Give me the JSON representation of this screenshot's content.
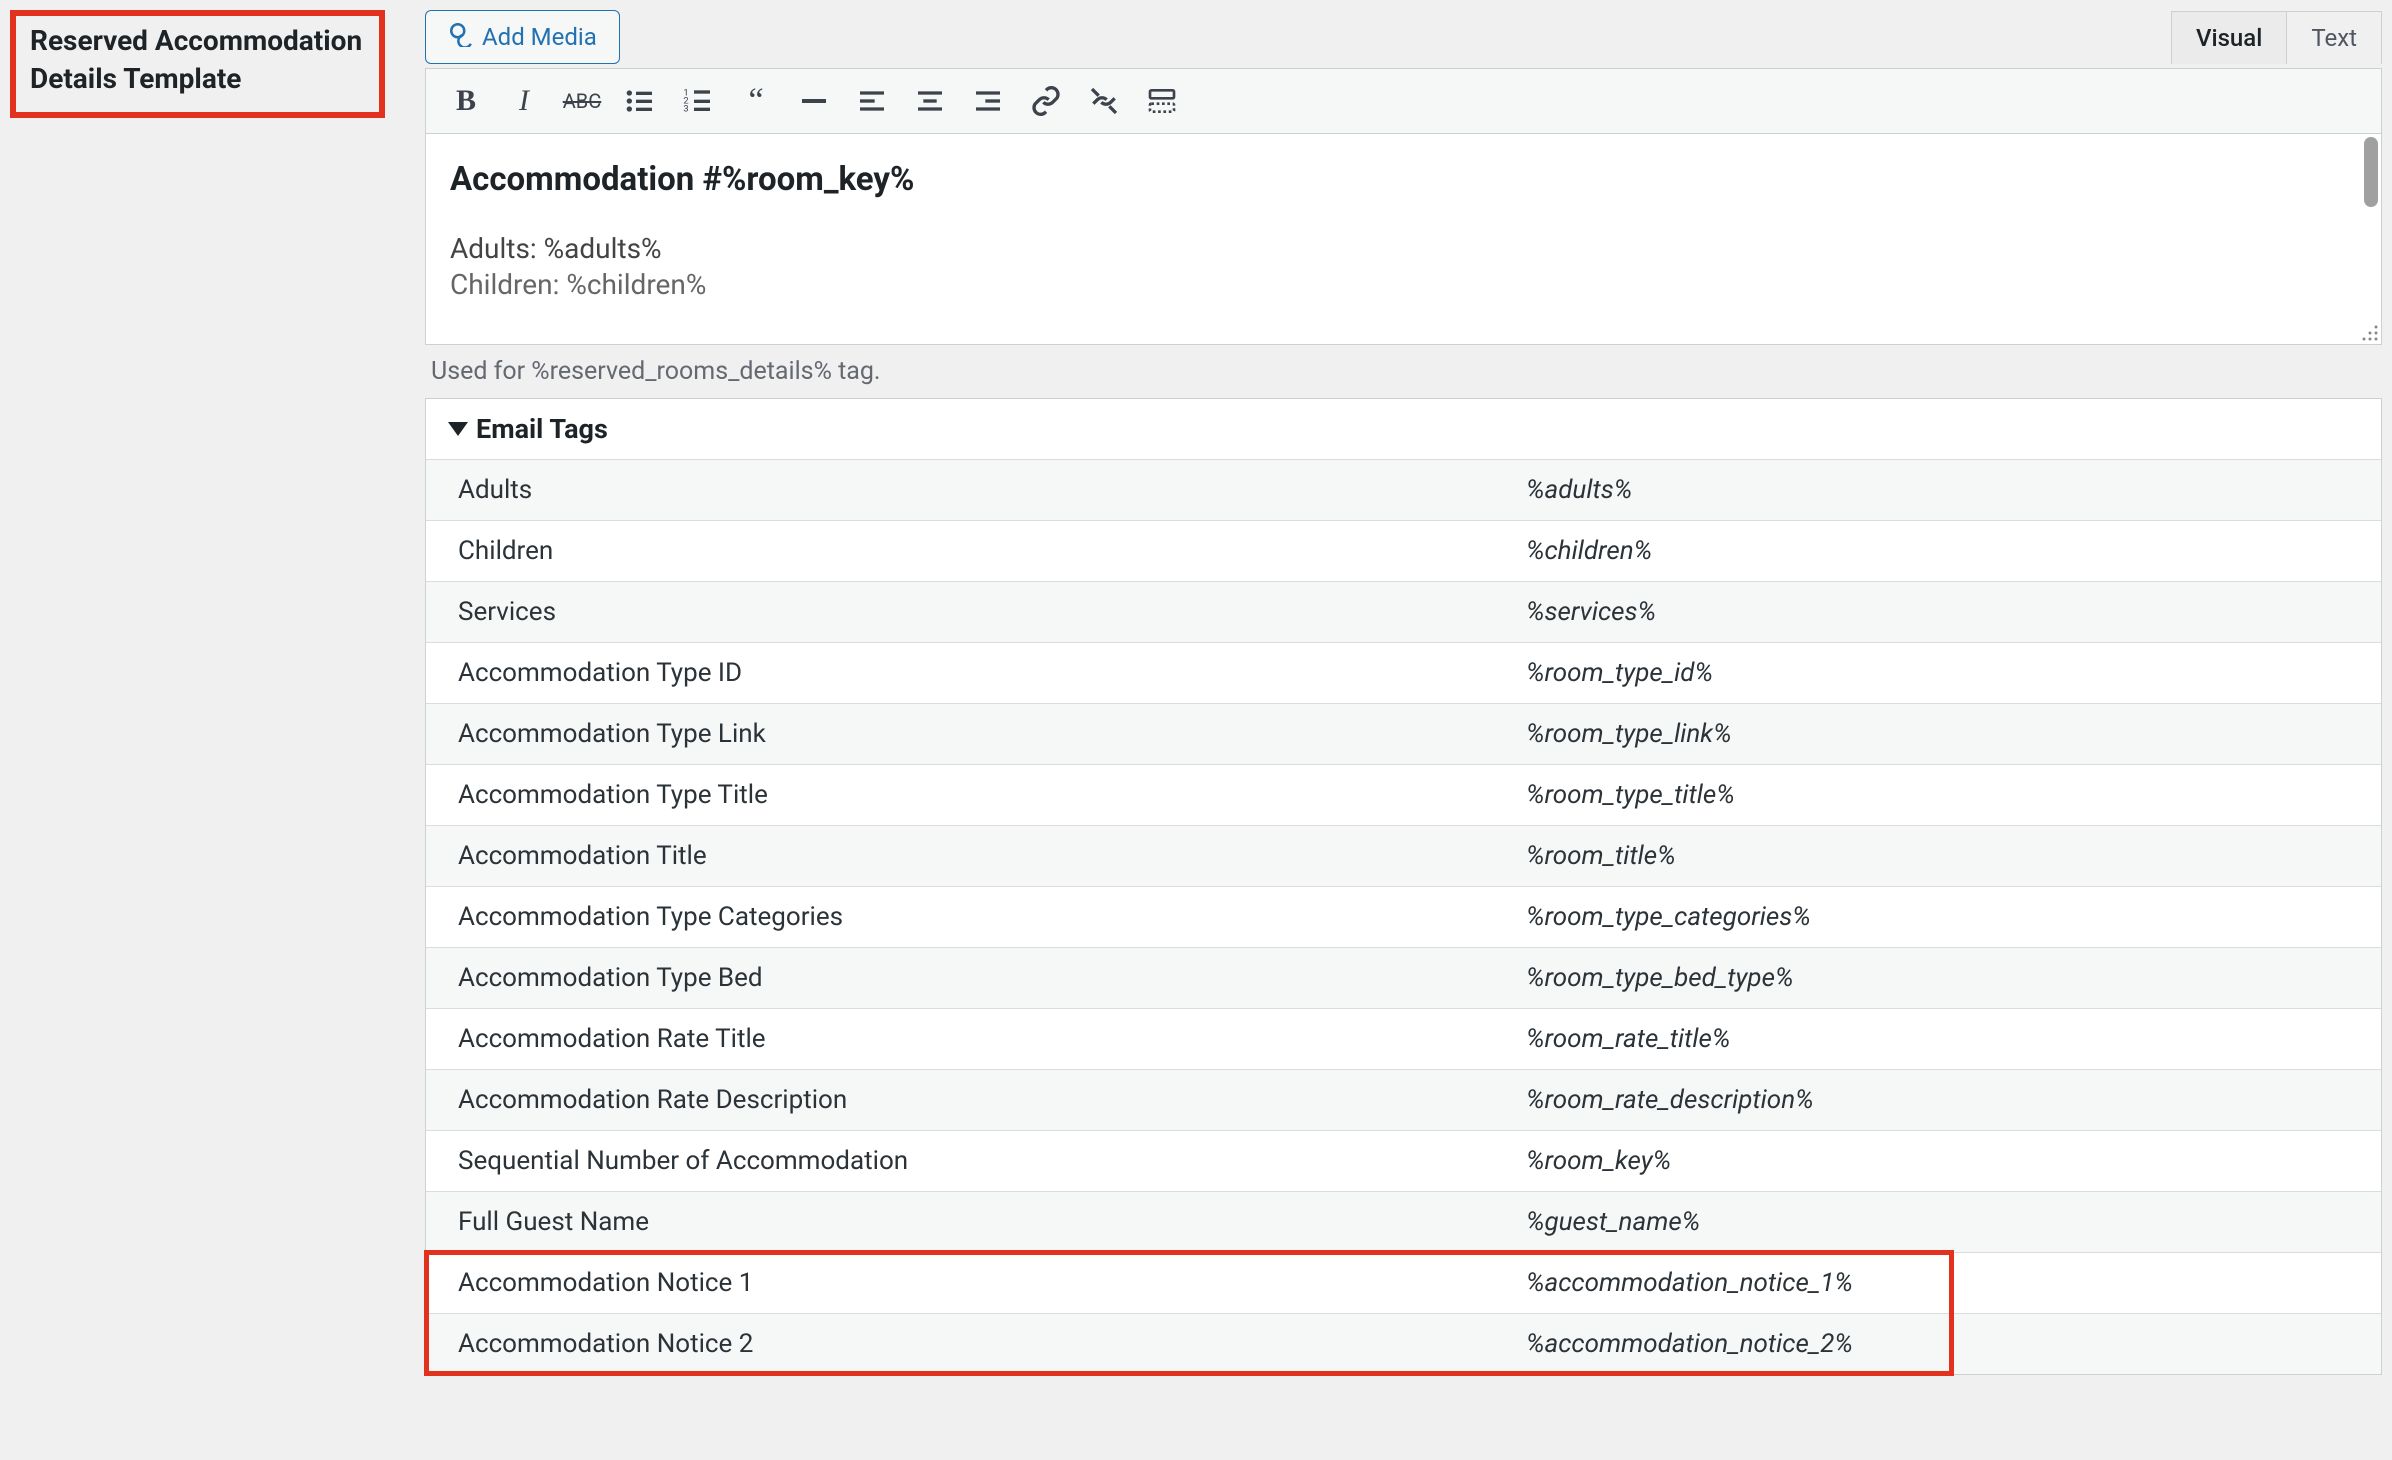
{
  "title": "Reserved Accommodation Details Template",
  "addMediaLabel": "Add Media",
  "tabs": {
    "visual": "Visual",
    "text": "Text"
  },
  "editor": {
    "heading": "Accommodation #%room_key%",
    "line1": "Adults: %adults%",
    "line2_partial": "Children: %children%"
  },
  "description": "Used for %reserved_rooms_details% tag.",
  "tagsHeader": "Email Tags",
  "rows": [
    {
      "label": "Adults",
      "tag": "%adults%"
    },
    {
      "label": "Children",
      "tag": "%children%"
    },
    {
      "label": "Services",
      "tag": "%services%"
    },
    {
      "label": "Accommodation Type ID",
      "tag": "%room_type_id%"
    },
    {
      "label": "Accommodation Type Link",
      "tag": "%room_type_link%"
    },
    {
      "label": "Accommodation Type Title",
      "tag": "%room_type_title%"
    },
    {
      "label": "Accommodation Title",
      "tag": "%room_title%"
    },
    {
      "label": "Accommodation Type Categories",
      "tag": "%room_type_categories%"
    },
    {
      "label": "Accommodation Type Bed",
      "tag": "%room_type_bed_type%"
    },
    {
      "label": "Accommodation Rate Title",
      "tag": "%room_rate_title%"
    },
    {
      "label": "Accommodation Rate Description",
      "tag": "%room_rate_description%"
    },
    {
      "label": "Sequential Number of Accommodation",
      "tag": "%room_key%"
    },
    {
      "label": "Full Guest Name",
      "tag": "%guest_name%"
    },
    {
      "label": "Accommodation Notice 1",
      "tag": "%accommodation_notice_1%"
    },
    {
      "label": "Accommodation Notice 2",
      "tag": "%accommodation_notice_2%"
    }
  ]
}
